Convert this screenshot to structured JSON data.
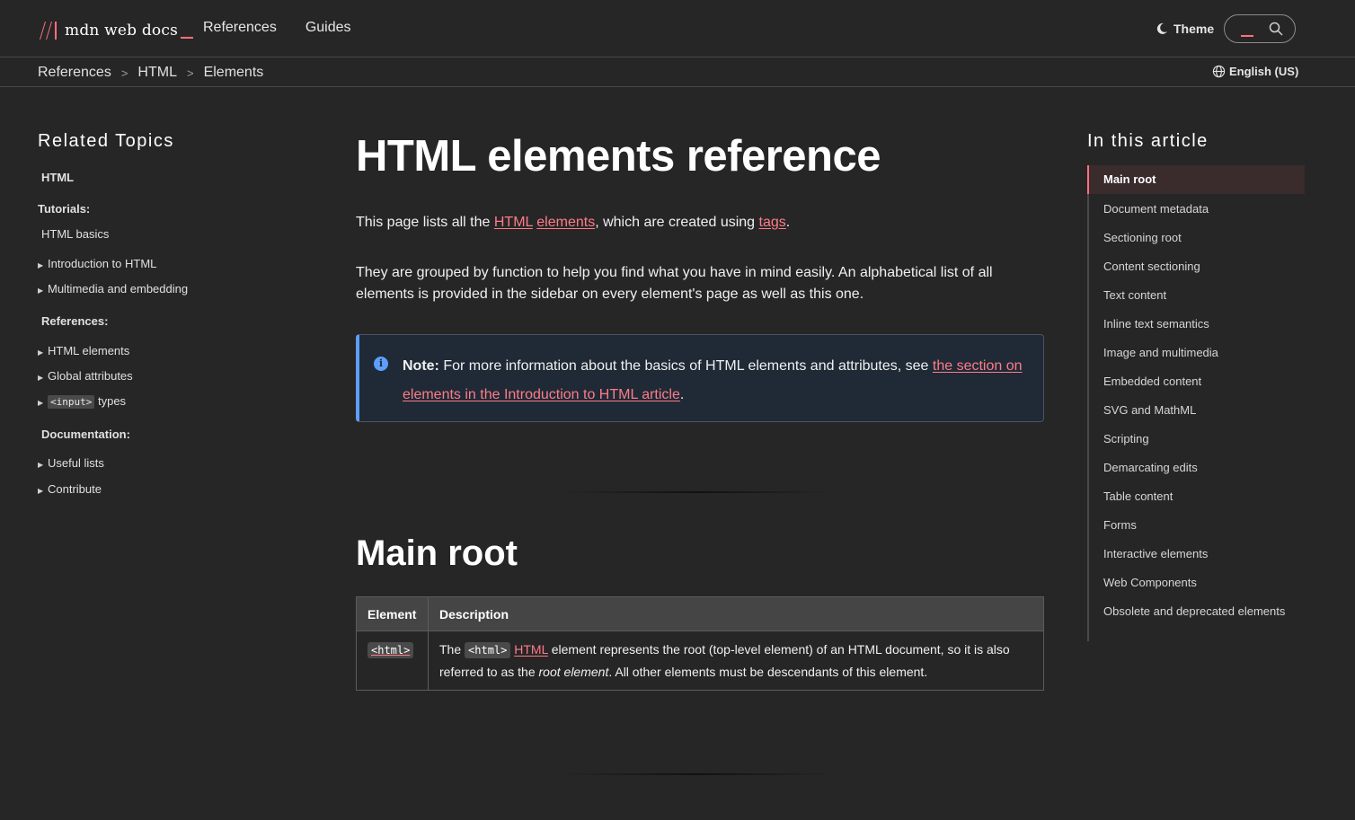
{
  "header": {
    "logo_text": "mdn web docs",
    "nav": [
      "References",
      "Guides"
    ],
    "theme_label": "Theme",
    "search_icon": "search-icon",
    "theme_icon": "moon-icon"
  },
  "breadcrumb": {
    "items": [
      "References",
      "HTML",
      "Elements"
    ],
    "language": "English (US)"
  },
  "sidebar": {
    "title": "Related Topics",
    "items": [
      {
        "label": "HTML",
        "kind": "head"
      },
      {
        "label": "Tutorials:",
        "kind": "section"
      },
      {
        "label": "HTML basics",
        "kind": "plain"
      },
      {
        "label": "Introduction to HTML",
        "kind": "collapsible"
      },
      {
        "label": "Multimedia and embedding",
        "kind": "collapsible"
      },
      {
        "label": "References:",
        "kind": "section"
      },
      {
        "label": "HTML elements",
        "kind": "collapsible"
      },
      {
        "label": "Global attributes",
        "kind": "collapsible"
      },
      {
        "label_code": "<input>",
        "label": " types",
        "kind": "collapsible"
      },
      {
        "label": "Documentation:",
        "kind": "section"
      },
      {
        "label": "Useful lists",
        "kind": "collapsible"
      },
      {
        "label": "Contribute",
        "kind": "collapsible"
      }
    ]
  },
  "main": {
    "title": "HTML elements reference",
    "intro": {
      "before": "This page lists all the ",
      "link1": "HTML",
      "space": " ",
      "link2": "elements",
      "middle": ", which are created using ",
      "link3": "tags",
      "after": "."
    },
    "paragraph2": "They are grouped by function to help you find what you have in mind easily. An alphabetical list of all elements is provided in the sidebar on every element's page as well as this one.",
    "note": {
      "label": "Note:",
      "text": " For more information about the basics of HTML elements and attributes, see ",
      "link": "the section on elements in the Introduction to HTML article",
      "after": "."
    },
    "section_title": "Main root",
    "table": {
      "headers": [
        "Element",
        "Description"
      ],
      "rows": [
        {
          "element": "<html>",
          "desc_before": "The ",
          "desc_code": "<html>",
          "desc_space": " ",
          "desc_link": "HTML",
          "desc_middle": " element represents the root (top-level element) of an HTML document, so it is also referred to as the ",
          "desc_em": "root element",
          "desc_after": ". All other elements must be descendants of this element."
        }
      ]
    }
  },
  "toc": {
    "title": "In this article",
    "active": "Main root",
    "items": [
      "Document metadata",
      "Sectioning root",
      "Content sectioning",
      "Text content",
      "Inline text semantics",
      "Image and multimedia",
      "Embedded content",
      "SVG and MathML",
      "Scripting",
      "Demarcating edits",
      "Table content",
      "Forms",
      "Interactive elements",
      "Web Components",
      "Obsolete and deprecated elements"
    ]
  },
  "colors": {
    "accent": "#ff707f",
    "link": "#ff7b88",
    "note_border": "#5e9eff",
    "background": "#262626"
  }
}
